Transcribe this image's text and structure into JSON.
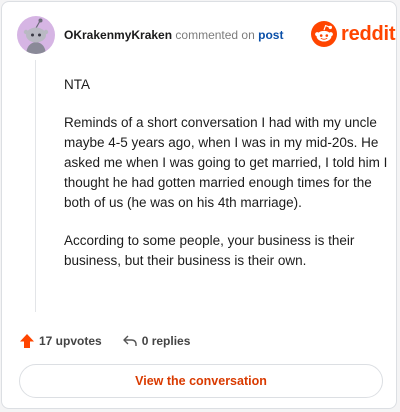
{
  "comment": {
    "author": "OKrakenmyKraken",
    "action_text": "commented on",
    "target_text": "post",
    "paragraphs": [
      "NTA",
      "Reminds of a short conversation I had with my uncle maybe 4-5 years ago, when I was in my mid-20s. He asked me when I was going to get married, I told him I thought he had gotten married enough times for the both of us (he was on his 4th marriage).",
      "According to some people, your business is their business, but their business is their own."
    ],
    "upvotes_label": "17 upvotes",
    "replies_label": "0 replies"
  },
  "brand": {
    "name": "reddit",
    "color": "#ff4500"
  },
  "avatar": {
    "icon": "snoo-avatar-icon",
    "background": "#d6b5e4"
  },
  "cta": {
    "label": "View the conversation",
    "color": "#d93a00"
  },
  "icons": {
    "upvote": "upvote-arrow-icon",
    "reply": "reply-arrow-icon",
    "logo": "reddit-snoo-icon"
  }
}
